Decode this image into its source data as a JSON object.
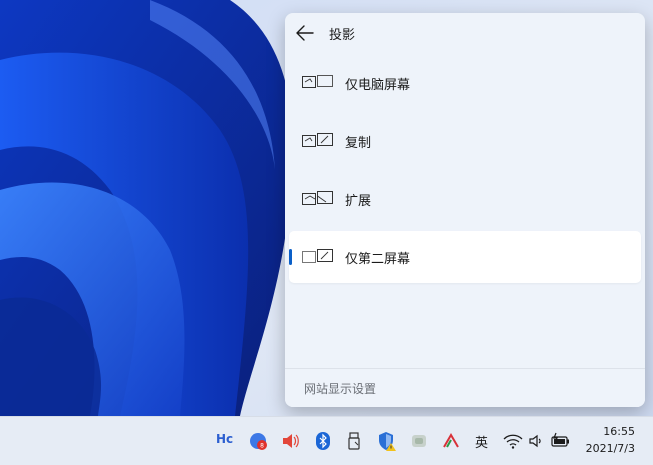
{
  "panel": {
    "title": "投影",
    "options": [
      {
        "label": "仅电脑屏幕",
        "icon": "pc-screen-only-icon",
        "selected": false
      },
      {
        "label": "复制",
        "icon": "duplicate-icon",
        "selected": false
      },
      {
        "label": "扩展",
        "icon": "extend-icon",
        "selected": false
      },
      {
        "label": "仅第二屏幕",
        "icon": "second-screen-only-icon",
        "selected": true
      }
    ],
    "footer_link": "网站显示设置"
  },
  "taskbar": {
    "tray": {
      "hc_label": "Hc",
      "ime_label": "英"
    },
    "clock": {
      "time": "16:55",
      "date": "2021/7/3"
    }
  },
  "colors": {
    "accent": "#0a5fc8",
    "panel_bg": "#eef3fa",
    "selected_bg": "#ffffff",
    "taskbar_bg": "#e6ecf5"
  }
}
